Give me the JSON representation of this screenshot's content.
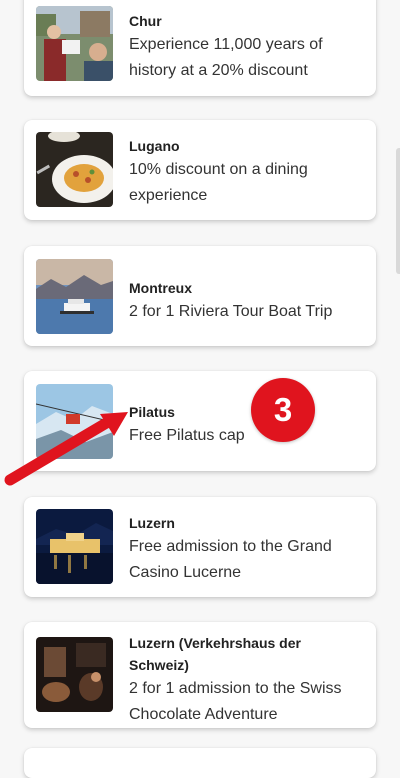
{
  "offers": [
    {
      "city": "Chur",
      "offer": "Experience 11,000 years of history at a 20% discount",
      "image": "chur-tour-photo"
    },
    {
      "city": "Lugano",
      "offer": "10% discount on a dining experience",
      "image": "lugano-risotto-photo"
    },
    {
      "city": "Montreux",
      "offer": "2 for 1 Riviera Tour Boat Trip",
      "image": "montreux-boat-photo"
    },
    {
      "city": "Pilatus",
      "offer": "Free Pilatus cap",
      "image": "pilatus-cable-car-photo"
    },
    {
      "city": "Luzern",
      "offer": "Free admission to the Grand Casino Lucerne",
      "image": "luzern-casino-photo"
    },
    {
      "city": "Luzern (Verkehrshaus der Schweiz)",
      "offer": "2 for 1 admission to the Swiss Chocolate Adventure",
      "image": "chocolate-adventure-photo"
    }
  ],
  "annotation": {
    "step_number": "3",
    "color": "#e0141e"
  }
}
